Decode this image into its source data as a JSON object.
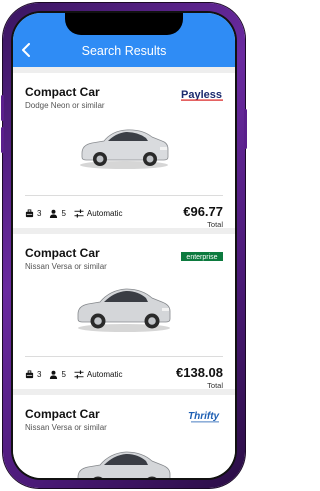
{
  "header": {
    "title": "Search Results"
  },
  "colors": {
    "accent": "#2f8cf5",
    "frame": "#6a2aa0"
  },
  "cars": [
    {
      "title": "Compact Car",
      "subtitle": "Dodge Neon or similar",
      "vendor_icon": "payless-logo",
      "bags": "3",
      "seats": "5",
      "transmission": "Automatic",
      "price": "€96.77",
      "price_label": "Total"
    },
    {
      "title": "Compact Car",
      "subtitle": "Nissan Versa or similar",
      "vendor_icon": "enterprise-logo",
      "bags": "3",
      "seats": "5",
      "transmission": "Automatic",
      "price": "€138.08",
      "price_label": "Total"
    },
    {
      "title": "Compact Car",
      "subtitle": "Nissan Versa or similar",
      "vendor_icon": "thrifty-logo",
      "bags": "",
      "seats": "",
      "transmission": "",
      "price": "",
      "price_label": ""
    }
  ]
}
